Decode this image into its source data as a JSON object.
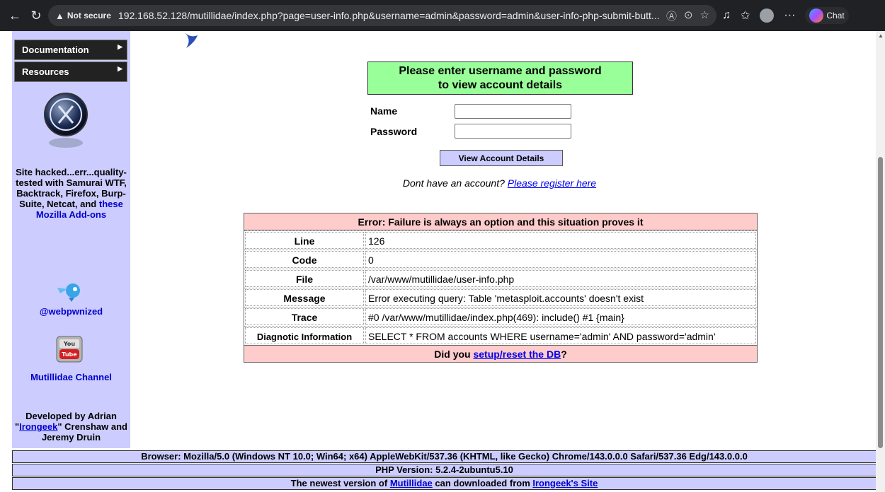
{
  "browser": {
    "security_label": "Not secure",
    "url": "192.168.52.128/mutillidae/index.php?page=user-info.php&username=admin&password=admin&user-info-php-submit-butt...",
    "chat_label": "Chat"
  },
  "sidebar": {
    "menu": [
      {
        "label": "Documentation"
      },
      {
        "label": "Resources"
      }
    ],
    "tested_text": "Site hacked...err...quality-tested with Samurai WTF, Backtrack, Firefox, Burp-Suite, Netcat, and",
    "tested_link": "these Mozilla Add-ons",
    "twitter_handle": "@webpwnized",
    "channel_label": "Mutillidae Channel",
    "developed_prefix": "Developed by Adrian \"",
    "developer_link": "Irongeek",
    "developed_suffix": "\" Crenshaw and Jeremy Druin"
  },
  "login": {
    "heading_line1": "Please enter username and password",
    "heading_line2": "to view account details",
    "name_label": "Name",
    "password_label": "Password",
    "name_value": "",
    "password_value": "",
    "submit_label": "View Account Details",
    "register_prompt": "Dont have an account?",
    "register_link": "Please register here"
  },
  "error": {
    "title": "Error: Failure is always an option and this situation proves it",
    "rows": [
      {
        "key": "Line",
        "value": "126"
      },
      {
        "key": "Code",
        "value": "0"
      },
      {
        "key": "File",
        "value": "/var/www/mutillidae/user-info.php"
      },
      {
        "key": "Message",
        "value": "Error executing query: Table 'metasploit.accounts' doesn't exist"
      },
      {
        "key": "Trace",
        "value": "#0 /var/www/mutillidae/index.php(469): include() #1 {main}"
      },
      {
        "key": "Diagnotic Information",
        "value": "SELECT * FROM accounts WHERE username='admin' AND password='admin'"
      }
    ],
    "footer_prefix": "Did you",
    "footer_link": "setup/reset the DB",
    "footer_suffix": "?"
  },
  "footer": {
    "browser_line": "Browser: Mozilla/5.0 (Windows NT 10.0; Win64; x64) AppleWebKit/537.36 (KHTML, like Gecko) Chrome/143.0.0.0 Safari/537.36 Edg/143.0.0.0",
    "php_line": "PHP Version: 5.2.4-2ubuntu5.10",
    "newest_prefix": "The newest version of",
    "newest_link": "Mutillidae",
    "newest_middle": "can downloaded from",
    "newest_site_link": "Irongeek's Site"
  }
}
